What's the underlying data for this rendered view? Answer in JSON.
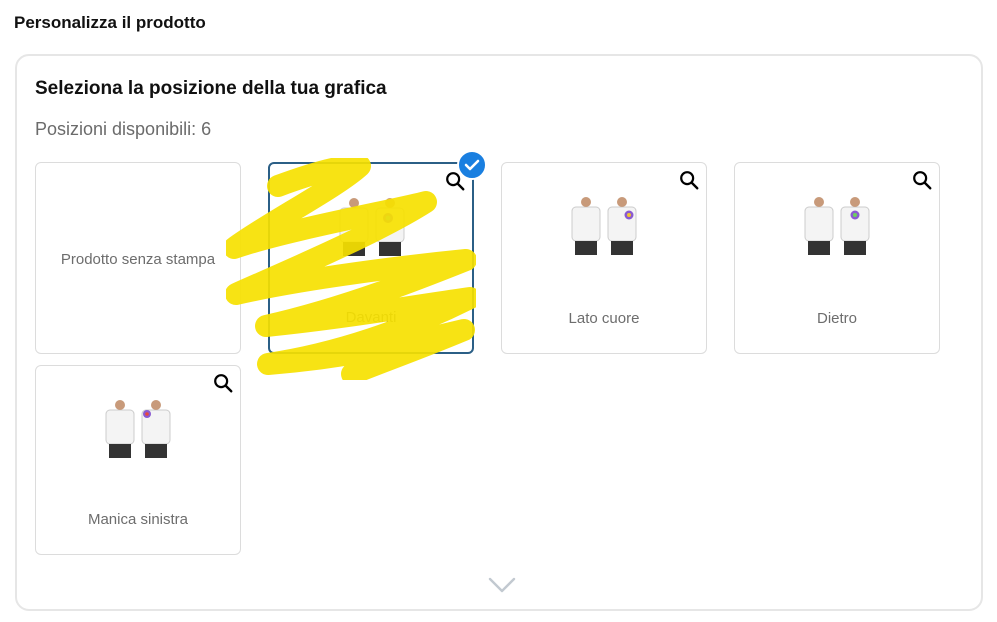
{
  "page": {
    "heading": "Personalizza il prodotto"
  },
  "panel": {
    "title": "Seleziona la posizione della tua grafica",
    "subtitle": "Posizioni disponibili: 6"
  },
  "options": [
    {
      "label": "Prodotto senza stampa",
      "selected": false,
      "has_zoom": false,
      "has_image": false
    },
    {
      "label": "Davanti",
      "selected": true,
      "has_zoom": true,
      "has_image": true
    },
    {
      "label": "Lato cuore",
      "selected": false,
      "has_zoom": true,
      "has_image": true
    },
    {
      "label": "Dietro",
      "selected": false,
      "has_zoom": true,
      "has_image": true
    },
    {
      "label": "Manica sinistra",
      "selected": false,
      "has_zoom": true,
      "has_image": true
    }
  ],
  "icons": {
    "zoom": "magnifier-icon",
    "selected": "checkmark-icon",
    "more": "chevron-down-icon"
  },
  "colors": {
    "selected_border": "#2b5f86",
    "check_badge": "#1a7fe0",
    "scribble": "#f6e100"
  }
}
